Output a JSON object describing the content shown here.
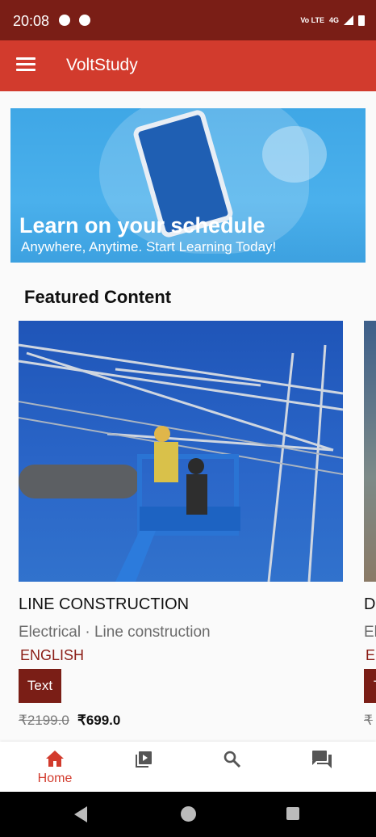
{
  "status_bar": {
    "time": "20:08",
    "network_label": "4G",
    "volte_label": "Vo LTE"
  },
  "app_bar": {
    "title": "VoltStudy"
  },
  "banner": {
    "headline": "Learn on your schedule",
    "subtitle": "Anywhere, Anytime. Start Learning Today!"
  },
  "featured": {
    "title": "Featured Content",
    "courses": [
      {
        "name": "LINE CONSTRUCTION",
        "category": "Electrical",
        "subcategory": "Line construction",
        "language": "ENGLISH",
        "type": "Text",
        "original_price": "₹2199.0",
        "price": "₹699.0"
      },
      {
        "name": "D",
        "category": "El",
        "subcategory": "",
        "language": "E",
        "type": "T",
        "original_price": "₹",
        "price": ""
      }
    ]
  },
  "bottom_nav": {
    "items": [
      {
        "label": "Home",
        "icon": "home-icon",
        "active": true
      },
      {
        "label": "",
        "icon": "video-library-icon",
        "active": false
      },
      {
        "label": "",
        "icon": "search-icon",
        "active": false
      },
      {
        "label": "",
        "icon": "chat-icon",
        "active": false
      }
    ]
  },
  "colors": {
    "primary": "#d23b2d",
    "primary_dark": "#7a1e16",
    "language_text": "#8b1d16"
  }
}
